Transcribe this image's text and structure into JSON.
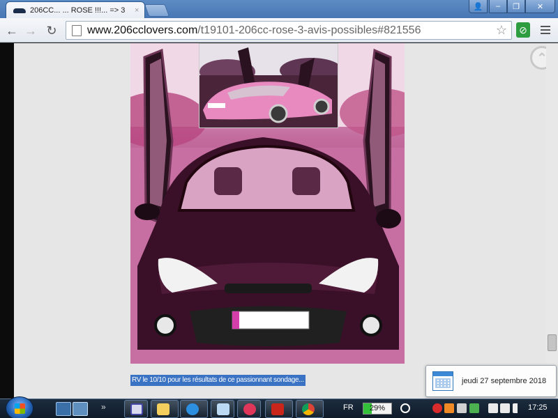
{
  "browser": {
    "tab_title": "206CC... ... ROSE !!!... =>  3",
    "tab_close": "×",
    "url_host": "www.206cclovers.com",
    "url_path": "/t19101-206cc-rose-3-avis-possibles#821556",
    "icons": [
      "back-icon",
      "forward-icon",
      "reload-icon",
      "page-icon",
      "star-icon",
      "clip-icon",
      "menu-icon"
    ]
  },
  "window_controls": {
    "user": "👤",
    "minimize": "–",
    "maximize": "❐",
    "close": "✕"
  },
  "nav": {
    "back": "←",
    "forward": "→",
    "reload": "↻",
    "star": "☆",
    "clip": "⊘"
  },
  "page": {
    "scroll_top_label": "⌃",
    "caption": "RV le 10/10 pour les résultats de ce passionnant sondage..."
  },
  "notification": {
    "date_text": "jeudi 27 septembre 2018"
  },
  "taskbar": {
    "chevron": "»",
    "language": "FR",
    "battery_percent": "29%",
    "battery_level": 0.29,
    "clock": "17:25",
    "colors": {
      "accent": "#3a72c4",
      "battery_fill": "#34c13a"
    }
  }
}
